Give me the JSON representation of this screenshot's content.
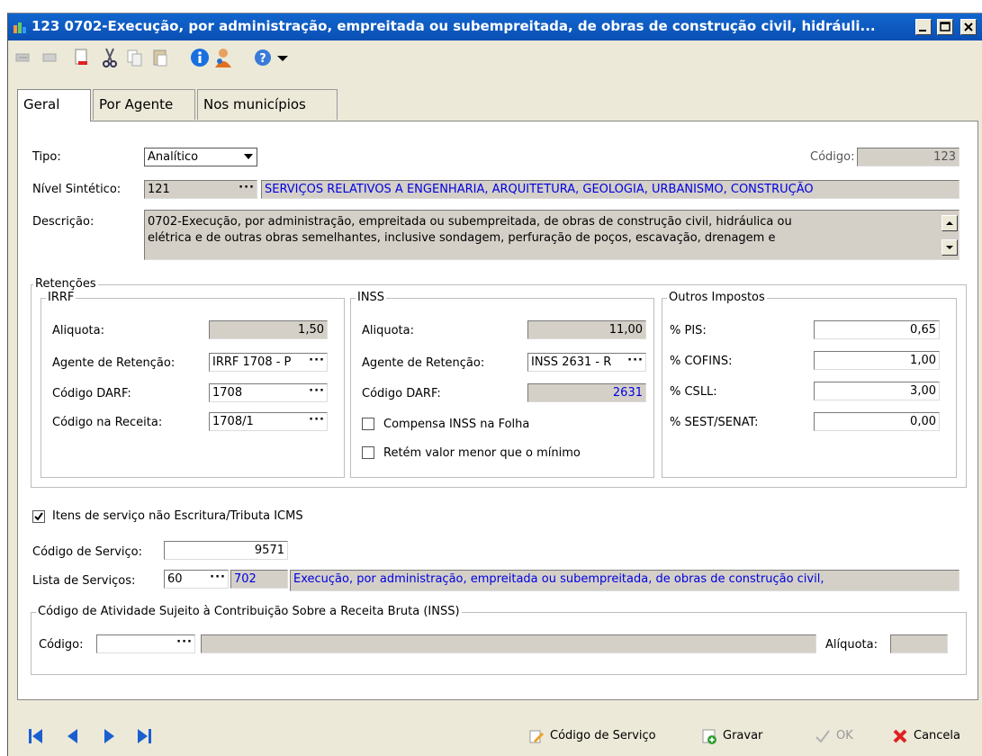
{
  "window": {
    "title": "123 0702-Execução, por administração, empreitada ou subempreitada, de obras de construção civil, hidráuli..."
  },
  "toolbar": {
    "icons": [
      "edit-icon",
      "undo-icon",
      "delete-icon",
      "cut-icon",
      "copy-icon",
      "paste-icon",
      "info-icon",
      "user-icon",
      "help-icon",
      "dropdown-arrow-icon"
    ]
  },
  "tabs": [
    {
      "label": "Geral",
      "active": true
    },
    {
      "label": "Por Agente",
      "active": false
    },
    {
      "label": "Nos municípios",
      "active": false
    }
  ],
  "general": {
    "tipo_label": "Tipo:",
    "tipo_value": "Analítico",
    "codigo_label": "Código:",
    "codigo_value": "123",
    "nivel_label": "Nível Sintético:",
    "nivel_value": "121",
    "nivel_desc": "SERVIÇOS RELATIVOS A ENGENHARIA, ARQUITETURA, GEOLOGIA, URBANISMO, CONSTRUÇÃO",
    "descricao_label": "Descrição:",
    "descricao_line1": "0702-Execução, por administração, empreitada ou subempreitada, de obras de construção civil, hidráulica ou",
    "descricao_line2": "elétrica e de outras obras semelhantes, inclusive sondagem, perfuração de poços, escavação, drenagem e"
  },
  "retencoes": {
    "title": "Retenções",
    "irrf": {
      "title": "IRRF",
      "aliquota_label": "Aliquota:",
      "aliquota_value": "1,50",
      "agente_label": "Agente de Retenção:",
      "agente_value": "IRRF 1708 - P",
      "darf_label": "Código DARF:",
      "darf_value": "1708",
      "receita_label": "Código na Receita:",
      "receita_value": "1708/1"
    },
    "inss": {
      "title": "INSS",
      "aliquota_label": "Aliquota:",
      "aliquota_value": "11,00",
      "agente_label": "Agente de Retenção:",
      "agente_value": "INSS 2631 - R",
      "darf_label": "Código DARF:",
      "darf_value": "2631",
      "compensa_label": "Compensa INSS na Folha",
      "compensa_checked": false,
      "retem_label": "Retém valor menor que o mínimo",
      "retem_checked": false
    },
    "outros": {
      "title": "Outros Impostos",
      "pis_label": "% PIS:",
      "pis_value": "0,65",
      "cofins_label": "% COFINS:",
      "cofins_value": "1,00",
      "csll_label": "% CSLL:",
      "csll_value": "3,00",
      "sest_label": "% SEST/SENAT:",
      "sest_value": "0,00"
    }
  },
  "servicos": {
    "itens_label": "Itens de serviço não Escritura/Tributa ICMS",
    "itens_checked": true,
    "codigo_servico_label": "Código de Serviço:",
    "codigo_servico_value": "9571",
    "lista_label": "Lista de Serviços:",
    "lista_value": "60",
    "lista_code": "702",
    "lista_desc": "Execução, por administração, empreitada ou subempreitada, de obras de construção civil,"
  },
  "atividade": {
    "title": "Código de Atividade Sujeito à Contribuição Sobre a Receita Bruta (INSS)",
    "codigo_label": "Código:",
    "codigo_value": "",
    "descricao_value": "",
    "aliquota_label": "Alíquota:",
    "aliquota_value": ""
  },
  "bottom": {
    "codigo_servico_btn": "Código de Serviço",
    "gravar_btn": "Gravar",
    "ok_btn": "OK",
    "cancela_btn": "Cancela"
  }
}
